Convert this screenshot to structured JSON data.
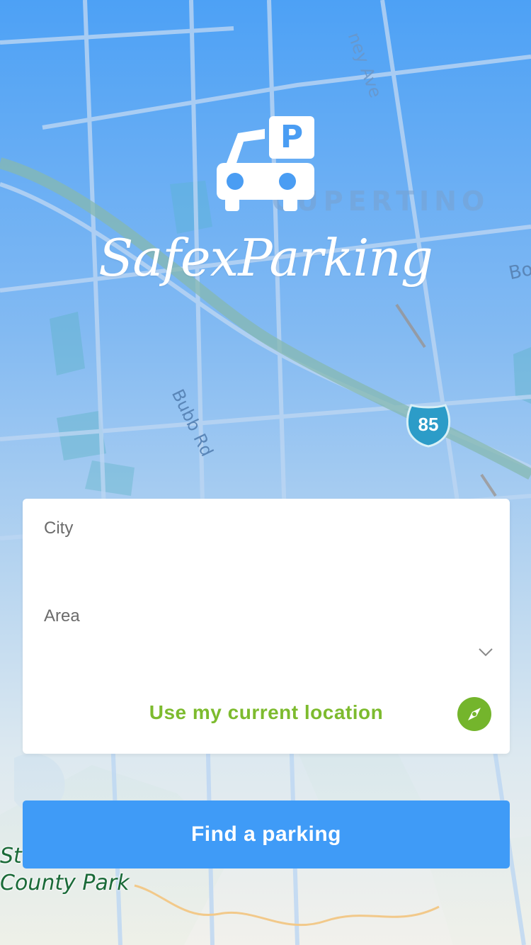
{
  "app": {
    "brand_name": "SafexParking",
    "logo_icon": "car-parking-icon"
  },
  "map": {
    "labels": {
      "area_name": "CUPERTINO",
      "street_1": "Bubb Rd",
      "street_2": "ney Ave",
      "street_3": "Bo",
      "park_name": "St\nCounty Park"
    },
    "highway_shield": "85"
  },
  "form": {
    "city_label": "City",
    "area_label": "Area",
    "area_dropdown_icon": "chevron-down-icon",
    "use_location_label": "Use my current location",
    "location_icon": "compass-icon"
  },
  "actions": {
    "find_parking_label": "Find a parking"
  },
  "colors": {
    "primary_blue": "#3f9bf7",
    "location_green": "#7dbb2e",
    "card_white": "#ffffff"
  }
}
